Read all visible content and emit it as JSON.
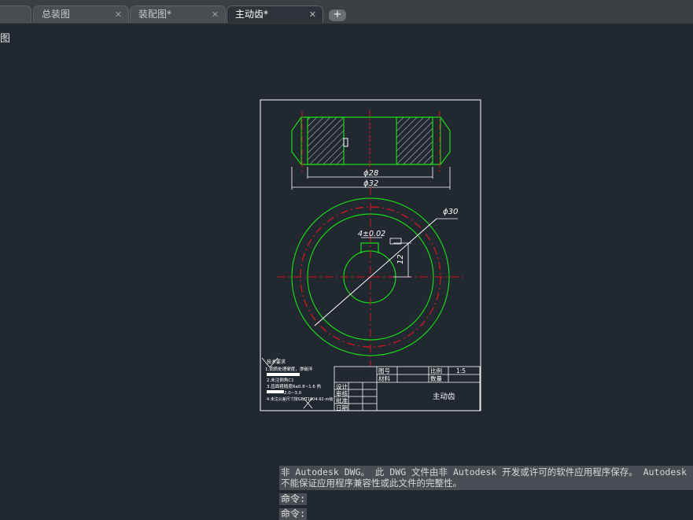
{
  "tabs": [
    {
      "label": "",
      "close": "✕"
    },
    {
      "label": "总装图",
      "close": "✕"
    },
    {
      "label": "装配图*",
      "close": "✕"
    },
    {
      "label": "主动齿*",
      "close": "✕"
    }
  ],
  "add_tab_symbol": "+",
  "viewport": {
    "label": "图"
  },
  "drawing": {
    "dim_phi28": "ϕ28",
    "dim_phi32": "ϕ32",
    "dim_phi30": "ϕ30",
    "dim_keyway": "4±0.02",
    "dim_12": "12",
    "roughness_top": "",
    "tech_req_title": "技术要求",
    "tech_req_lines": [
      "1.调质处理硬度，渗碳淬",
      "2.未注倒角C1",
      "3.齿面粗糙度Ra0.8~1.6 热",
      "  2.0~3.0",
      "4.未注公差尺寸按GB/T1804-92-m级"
    ],
    "title_block": {
      "labels_left": [
        "设计",
        "审核",
        "批准",
        "日期"
      ],
      "part_label": "图号",
      "material_label": "材料",
      "scale_label": "比例",
      "scale_value": "1:5",
      "qty_label": "数量",
      "part_name": "主动齿"
    }
  },
  "command_history": [
    "非 Autodesk DWG。  此 DWG 文件由非 Autodesk 开发或许可的软件应用程序保存。  Autodesk",
    "不能保证应用程序兼容性或此文件的完整性。"
  ],
  "prompts": [
    "命令:",
    "命令:"
  ],
  "colors": {
    "green": "#18d818",
    "red": "#e0141c",
    "white": "#ffffff",
    "canvas": "#212830"
  }
}
